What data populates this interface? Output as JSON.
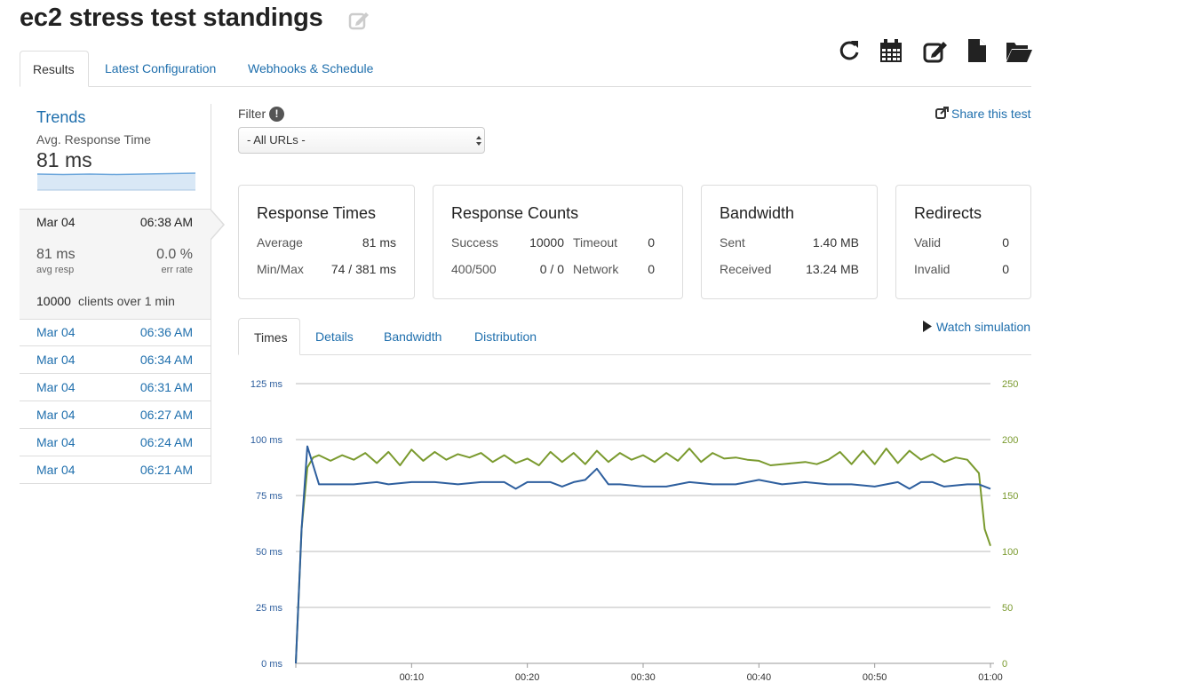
{
  "header": {
    "title": "ec2 stress test standings"
  },
  "tabs": [
    {
      "label": "Results",
      "active": true
    },
    {
      "label": "Latest Configuration",
      "active": false
    },
    {
      "label": "Webhooks & Schedule",
      "active": false
    }
  ],
  "toolbar_icons": [
    "refresh-icon",
    "calendar-icon",
    "edit-icon",
    "file-icon",
    "folder-open-icon"
  ],
  "sidebar": {
    "trends_title": "Trends",
    "trends_metric": "Avg. Response Time",
    "trends_value": "81 ms",
    "current": {
      "date": "Mar 04",
      "time": "06:38 AM",
      "avg_resp_value": "81 ms",
      "avg_resp_label": "avg resp",
      "err_rate_value": "0.0 %",
      "err_rate_label": "err rate",
      "clients": "10000",
      "clients_suffix": "clients over 1 min"
    },
    "history": [
      {
        "date": "Mar 04",
        "time": "06:36 AM"
      },
      {
        "date": "Mar 04",
        "time": "06:34 AM"
      },
      {
        "date": "Mar 04",
        "time": "06:31 AM"
      },
      {
        "date": "Mar 04",
        "time": "06:27 AM"
      },
      {
        "date": "Mar 04",
        "time": "06:24 AM"
      },
      {
        "date": "Mar 04",
        "time": "06:21 AM"
      }
    ]
  },
  "filter": {
    "label": "Filter",
    "info_glyph": "!",
    "selected": "- All URLs -"
  },
  "share_label": "Share this test",
  "cards": {
    "response_times": {
      "title": "Response Times",
      "average_label": "Average",
      "average": "81 ms",
      "minmax_label": "Min/Max",
      "minmax": "74 / 381 ms"
    },
    "response_counts": {
      "title": "Response Counts",
      "success_label": "Success",
      "success": "10000",
      "timeout_label": "Timeout",
      "timeout": "0",
      "err_label": "400/500",
      "err": "0 / 0",
      "network_label": "Network",
      "network": "0"
    },
    "bandwidth": {
      "title": "Bandwidth",
      "sent_label": "Sent",
      "sent": "1.40 MB",
      "received_label": "Received",
      "received": "13.24 MB"
    },
    "redirects": {
      "title": "Redirects",
      "valid_label": "Valid",
      "valid": "0",
      "invalid_label": "Invalid",
      "invalid": "0"
    }
  },
  "subtabs": [
    {
      "label": "Times",
      "active": true
    },
    {
      "label": "Details",
      "active": false
    },
    {
      "label": "Bandwidth",
      "active": false
    },
    {
      "label": "Distribution",
      "active": false
    }
  ],
  "watch_label": "Watch simulation",
  "colors": {
    "link": "#1f6fad",
    "response_line": "#2e5f9e",
    "clients_line": "#7a9a2e",
    "grid": "#bbbbbb"
  },
  "chart_data": {
    "type": "line",
    "x_ticks": [
      "00:10",
      "00:20",
      "00:30",
      "00:40",
      "00:50",
      "01:00"
    ],
    "y_left_ticks": [
      "0 ms",
      "25 ms",
      "50 ms",
      "75 ms",
      "100 ms",
      "125 ms"
    ],
    "y_right_ticks": [
      "0",
      "50",
      "100",
      "150",
      "200",
      "250"
    ],
    "y_left_range": [
      0,
      125
    ],
    "y_right_range": [
      0,
      250
    ],
    "x_range_seconds": [
      0,
      60
    ],
    "grid": true,
    "series": [
      {
        "axis": "left",
        "x": [
          0,
          0.5,
          1,
          2,
          3,
          5,
          7,
          8,
          10,
          12,
          14,
          16,
          18,
          19,
          20,
          22,
          23,
          24,
          25,
          26,
          27,
          28,
          30,
          32,
          34,
          36,
          38,
          40,
          42,
          44,
          46,
          48,
          50,
          52,
          53,
          54,
          55,
          56,
          58,
          59,
          60
        ],
        "values": [
          0,
          60,
          97,
          80,
          80,
          80,
          81,
          80,
          81,
          81,
          80,
          81,
          81,
          78,
          81,
          81,
          79,
          81,
          82,
          87,
          80,
          80,
          79,
          79,
          81,
          80,
          80,
          82,
          80,
          81,
          80,
          80,
          79,
          81,
          78,
          81,
          81,
          79,
          80,
          80,
          78
        ]
      },
      {
        "axis": "right",
        "x": [
          0,
          0.5,
          1,
          1.5,
          2,
          3,
          4,
          5,
          6,
          7,
          8,
          9,
          10,
          11,
          12,
          13,
          14,
          15,
          16,
          17,
          18,
          19,
          20,
          21,
          22,
          23,
          24,
          25,
          26,
          27,
          28,
          29,
          30,
          31,
          32,
          33,
          34,
          35,
          36,
          37,
          38,
          39,
          40,
          41,
          42,
          43,
          44,
          45,
          46,
          47,
          48,
          49,
          50,
          51,
          52,
          53,
          54,
          55,
          56,
          57,
          58,
          59,
          59.5,
          60
        ],
        "values": [
          0,
          120,
          175,
          184,
          186,
          181,
          186,
          182,
          188,
          179,
          189,
          177,
          191,
          181,
          189,
          182,
          187,
          184,
          188,
          180,
          186,
          179,
          183,
          177,
          189,
          180,
          188,
          178,
          190,
          180,
          188,
          182,
          186,
          180,
          188,
          181,
          192,
          180,
          188,
          183,
          184,
          182,
          181,
          177,
          178,
          179,
          180,
          178,
          182,
          189,
          178,
          190,
          178,
          192,
          179,
          190,
          182,
          187,
          180,
          184,
          182,
          170,
          120,
          105
        ]
      }
    ]
  }
}
